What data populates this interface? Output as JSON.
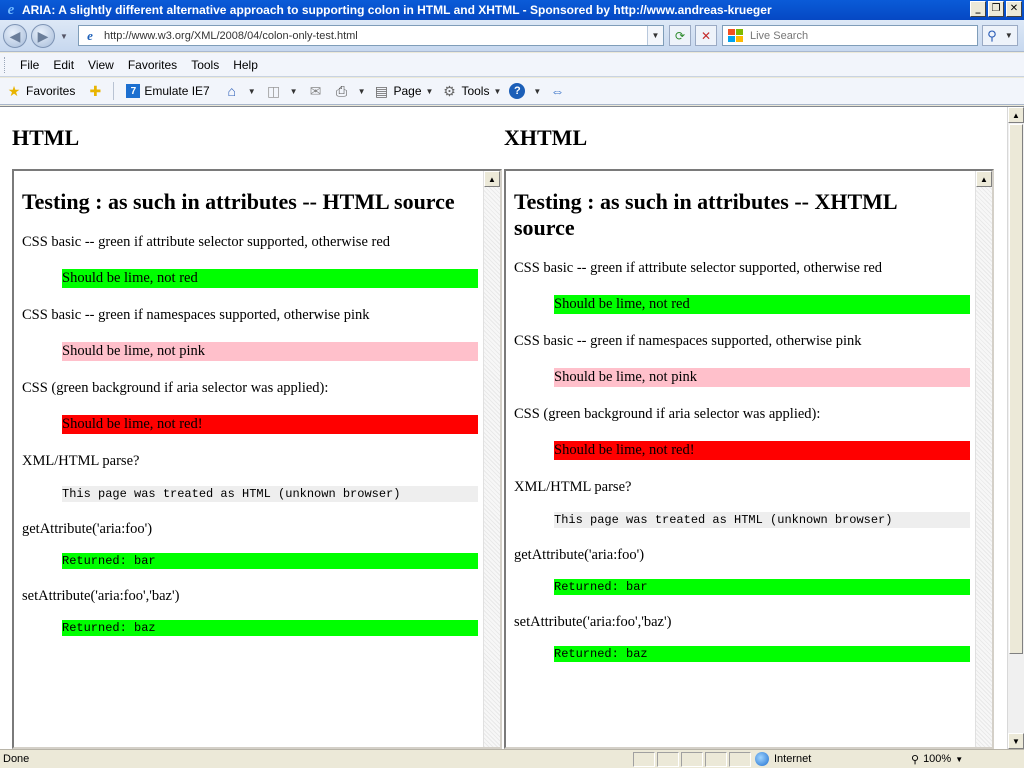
{
  "window": {
    "title": "ARIA: A slightly different alternative approach to supporting colon in HTML and XHTML - Sponsored by http://www.andreas-krueger",
    "minimize": "_",
    "restore": "❐",
    "close": "✕"
  },
  "address": {
    "url": "http://www.w3.org/XML/2008/04/colon-only-test.html",
    "search_placeholder": "Live Search"
  },
  "menu": [
    "File",
    "Edit",
    "View",
    "Favorites",
    "Tools",
    "Help"
  ],
  "commandbar": {
    "favorites": "Favorites",
    "emulate": "Emulate IE7",
    "page": "Page",
    "tools": "Tools"
  },
  "page": {
    "heading_left": "HTML",
    "heading_right": "XHTML"
  },
  "frames": [
    {
      "title": "Testing : as such in attributes -- HTML source",
      "tests": [
        {
          "label": "CSS basic -- green if attribute selector supported, otherwise red",
          "result": "Should be lime, not red"
        },
        {
          "label": "CSS basic -- green if namespaces supported, otherwise pink",
          "result": "Should be lime, not pink"
        },
        {
          "label": "CSS (green background if aria selector was applied):",
          "result": "Should be lime, not red!"
        },
        {
          "label": "XML/HTML parse?",
          "result": "This page was treated as HTML (unknown browser)"
        },
        {
          "label": "getAttribute('aria:foo')",
          "result": "Returned: bar"
        },
        {
          "label": "setAttribute('aria:foo','baz')",
          "result": "Returned: baz"
        }
      ]
    },
    {
      "title": "Testing : as such in attributes -- XHTML source",
      "tests": [
        {
          "label": "CSS basic -- green if attribute selector supported, otherwise red",
          "result": "Should be lime, not red"
        },
        {
          "label": "CSS basic -- green if namespaces supported, otherwise pink",
          "result": "Should be lime, not pink"
        },
        {
          "label": "CSS (green background if aria selector was applied):",
          "result": "Should be lime, not red!"
        },
        {
          "label": "XML/HTML parse?",
          "result": "This page was treated as HTML (unknown browser)"
        },
        {
          "label": "getAttribute('aria:foo')",
          "result": "Returned: bar"
        },
        {
          "label": "setAttribute('aria:foo','baz')",
          "result": "Returned: baz"
        }
      ]
    }
  ],
  "colors": {
    "lime": "#00ff00",
    "pink": "#ffc0cb",
    "red": "#ff0000",
    "grey": "#eeeeee"
  },
  "status": {
    "text": "Done",
    "zone": "Internet",
    "zoom": "100%"
  }
}
